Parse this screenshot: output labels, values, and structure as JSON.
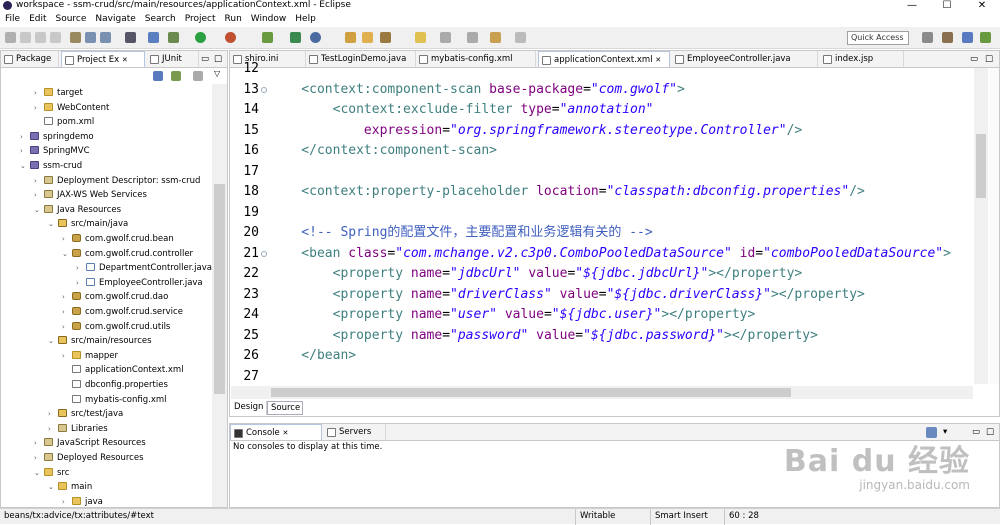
{
  "window": {
    "title": "workspace - ssm-crud/src/main/resources/applicationContext.xml - Eclipse",
    "minimize": "—",
    "maximize": "☐",
    "close": "✕"
  },
  "menu": [
    "File",
    "Edit",
    "Source",
    "Navigate",
    "Search",
    "Project",
    "Run",
    "Window",
    "Help"
  ],
  "quick_access": "Quick Access",
  "left_tabs": [
    "Package",
    "Project Ex",
    "JUnit"
  ],
  "tree": [
    {
      "label": "target",
      "depth": 1,
      "arrow": "›",
      "icon": "folder"
    },
    {
      "label": "WebContent",
      "depth": 1,
      "arrow": "›",
      "icon": "folder"
    },
    {
      "label": "pom.xml",
      "depth": 1,
      "arrow": "",
      "icon": "xml"
    },
    {
      "label": "springdemo",
      "depth": 0,
      "arrow": "›",
      "icon": "proj"
    },
    {
      "label": "SpringMVC",
      "depth": 0,
      "arrow": "›",
      "icon": "proj"
    },
    {
      "label": "ssm-crud",
      "depth": 0,
      "arrow": "⌄",
      "icon": "proj"
    },
    {
      "label": "Deployment Descriptor: ssm-crud",
      "depth": 1,
      "arrow": "›",
      "icon": "lib"
    },
    {
      "label": "JAX-WS Web Services",
      "depth": 1,
      "arrow": "›",
      "icon": "lib"
    },
    {
      "label": "Java Resources",
      "depth": 1,
      "arrow": "⌄",
      "icon": "lib"
    },
    {
      "label": "src/main/java",
      "depth": 2,
      "arrow": "⌄",
      "icon": "src"
    },
    {
      "label": "com.gwolf.crud.bean",
      "depth": 3,
      "arrow": "›",
      "icon": "pkg"
    },
    {
      "label": "com.gwolf.crud.controller",
      "depth": 3,
      "arrow": "⌄",
      "icon": "pkg"
    },
    {
      "label": "DepartmentController.java",
      "depth": 4,
      "arrow": "›",
      "icon": "java"
    },
    {
      "label": "EmployeeController.java",
      "depth": 4,
      "arrow": "›",
      "icon": "java"
    },
    {
      "label": "com.gwolf.crud.dao",
      "depth": 3,
      "arrow": "›",
      "icon": "pkg"
    },
    {
      "label": "com.gwolf.crud.service",
      "depth": 3,
      "arrow": "›",
      "icon": "pkg"
    },
    {
      "label": "com.gwolf.crud.utils",
      "depth": 3,
      "arrow": "›",
      "icon": "pkg"
    },
    {
      "label": "src/main/resources",
      "depth": 2,
      "arrow": "⌄",
      "icon": "src"
    },
    {
      "label": "mapper",
      "depth": 3,
      "arrow": "›",
      "icon": "folder"
    },
    {
      "label": "applicationContext.xml",
      "depth": 3,
      "arrow": "",
      "icon": "xml"
    },
    {
      "label": "dbconfig.properties",
      "depth": 3,
      "arrow": "",
      "icon": "xml"
    },
    {
      "label": "mybatis-config.xml",
      "depth": 3,
      "arrow": "",
      "icon": "xml"
    },
    {
      "label": "src/test/java",
      "depth": 2,
      "arrow": "›",
      "icon": "src"
    },
    {
      "label": "Libraries",
      "depth": 2,
      "arrow": "›",
      "icon": "lib"
    },
    {
      "label": "JavaScript Resources",
      "depth": 1,
      "arrow": "›",
      "icon": "lib"
    },
    {
      "label": "Deployed Resources",
      "depth": 1,
      "arrow": "›",
      "icon": "lib"
    },
    {
      "label": "src",
      "depth": 1,
      "arrow": "⌄",
      "icon": "folder"
    },
    {
      "label": "main",
      "depth": 2,
      "arrow": "⌄",
      "icon": "folder"
    },
    {
      "label": "java",
      "depth": 3,
      "arrow": "›",
      "icon": "folder"
    }
  ],
  "editor_tabs": [
    "shiro.ini",
    "TestLoginDemo.java",
    "mybatis-config.xml",
    "applicationContext.xml",
    "EmployeeController.java",
    "index.jsp"
  ],
  "active_editor_tab": "applicationContext.xml",
  "line_numbers": [
    "12",
    "13",
    "14",
    "15",
    "16",
    "17",
    "18",
    "19",
    "20",
    "21",
    "22",
    "23",
    "24",
    "25",
    "26",
    "27"
  ],
  "code_lines": [
    [],
    [
      [
        "t",
        "    <context:component-scan "
      ],
      [
        "a",
        "base-package"
      ],
      [
        "p",
        "="
      ],
      [
        "v",
        "\"com.gwolf\""
      ],
      [
        "t",
        ">"
      ]
    ],
    [
      [
        "t",
        "        <context:exclude-filter "
      ],
      [
        "a",
        "type"
      ],
      [
        "p",
        "="
      ],
      [
        "v",
        "\"annotation\""
      ]
    ],
    [
      [
        "p",
        "            "
      ],
      [
        "a",
        "expression"
      ],
      [
        "p",
        "="
      ],
      [
        "v",
        "\"org.springframework.stereotype.Controller\""
      ],
      [
        "t",
        "/>"
      ]
    ],
    [
      [
        "t",
        "    </context:component-scan>"
      ]
    ],
    [],
    [
      [
        "t",
        "    <context:property-placeholder "
      ],
      [
        "a",
        "location"
      ],
      [
        "p",
        "="
      ],
      [
        "v",
        "\"classpath:dbconfig.properties\""
      ],
      [
        "t",
        "/>"
      ]
    ],
    [],
    [
      [
        "c",
        "    <!-- Spring的配置文件，主要配置和业务逻辑有关的 -->"
      ]
    ],
    [
      [
        "t",
        "    <bean "
      ],
      [
        "a",
        "class"
      ],
      [
        "p",
        "="
      ],
      [
        "v",
        "\"com.mchange.v2.c3p0.ComboPooledDataSource\""
      ],
      [
        "p",
        " "
      ],
      [
        "a",
        "id"
      ],
      [
        "p",
        "="
      ],
      [
        "v",
        "\"comboPooledDataSource\""
      ],
      [
        "t",
        ">"
      ]
    ],
    [
      [
        "t",
        "        <property "
      ],
      [
        "a",
        "name"
      ],
      [
        "p",
        "="
      ],
      [
        "v",
        "\"jdbcUrl\""
      ],
      [
        "p",
        " "
      ],
      [
        "a",
        "value"
      ],
      [
        "p",
        "="
      ],
      [
        "v",
        "\"${jdbc.jdbcUrl}\""
      ],
      [
        "t",
        "></property>"
      ]
    ],
    [
      [
        "t",
        "        <property "
      ],
      [
        "a",
        "name"
      ],
      [
        "p",
        "="
      ],
      [
        "v",
        "\"driverClass\""
      ],
      [
        "p",
        " "
      ],
      [
        "a",
        "value"
      ],
      [
        "p",
        "="
      ],
      [
        "v",
        "\"${jdbc.driverClass}\""
      ],
      [
        "t",
        "></property>"
      ]
    ],
    [
      [
        "t",
        "        <property "
      ],
      [
        "a",
        "name"
      ],
      [
        "p",
        "="
      ],
      [
        "v",
        "\"user\""
      ],
      [
        "p",
        " "
      ],
      [
        "a",
        "value"
      ],
      [
        "p",
        "="
      ],
      [
        "v",
        "\"${jdbc.user}\""
      ],
      [
        "t",
        "></property>"
      ]
    ],
    [
      [
        "t",
        "        <property "
      ],
      [
        "a",
        "name"
      ],
      [
        "p",
        "="
      ],
      [
        "v",
        "\"password\""
      ],
      [
        "p",
        " "
      ],
      [
        "a",
        "value"
      ],
      [
        "p",
        "="
      ],
      [
        "v",
        "\"${jdbc.password}\""
      ],
      [
        "t",
        "></property>"
      ]
    ],
    [
      [
        "t",
        "    </bean>"
      ]
    ],
    []
  ],
  "bottom_editor_tabs": [
    "Design",
    "Source"
  ],
  "console_tabs": [
    "Console",
    "Servers"
  ],
  "console_message": "No consoles to display at this time.",
  "status": {
    "path": "beans/tx:advice/tx:attributes/#text",
    "mode": "Writable",
    "insert": "Smart Insert",
    "position": "60 : 28"
  },
  "watermark": {
    "main": "Bai du 经验",
    "sub": "jingyan.baidu.com"
  }
}
